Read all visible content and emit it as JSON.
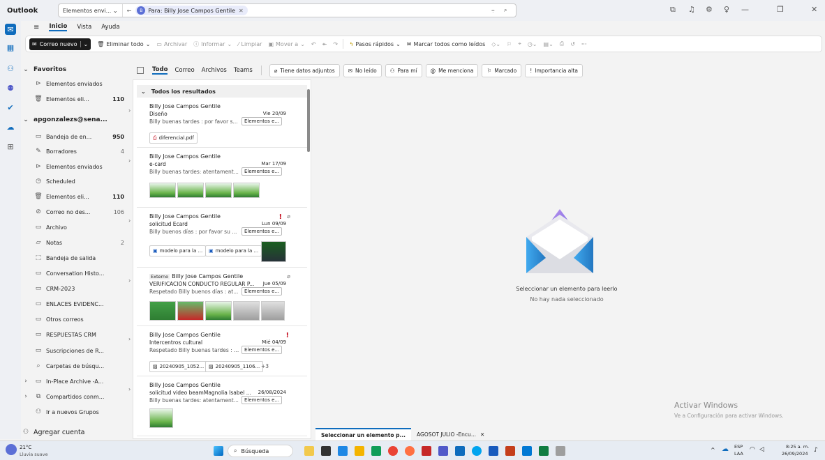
{
  "titlebar": {
    "app": "Outlook",
    "scope": "Elementos envi...",
    "search_chip_initial": "B",
    "search_chip": "Para: Billy Jose Campos Gentile",
    "filter_icon": "filter-icon",
    "search_icon": "search-icon"
  },
  "tabs": [
    "Inicio",
    "Vista",
    "Ayuda"
  ],
  "ribbon": {
    "new_mail": "Correo nuevo",
    "delete_all": "Eliminar todo",
    "archive": "Archivar",
    "report": "Informar",
    "clean": "Limpiar",
    "move_to": "Mover a",
    "quick_steps": "Pasos rápidos",
    "mark_all_read": "Marcar todos como leídos",
    "more": "···"
  },
  "folders": {
    "favorites": "Favoritos",
    "fav_sent": "Elementos enviados",
    "fav_deleted": "Elementos eli...",
    "fav_deleted_count": "110",
    "account": "apgonzalezs@sena...",
    "inbox": "Bandeja de en...",
    "inbox_count": "950",
    "drafts": "Borradores",
    "drafts_count": "4",
    "sent": "Elementos enviados",
    "scheduled": "Scheduled",
    "deleted": "Elementos eli...",
    "deleted_count": "110",
    "junk": "Correo no des...",
    "junk_count": "106",
    "archive": "Archivo",
    "notes": "Notas",
    "notes_count": "2",
    "outbox": "Bandeja de salida",
    "conv_history": "Conversation Histo...",
    "crm": "CRM-2023",
    "enlaces": "ENLACES EVIDENC...",
    "otros": "Otros correos",
    "respuestas": "RESPUESTAS CRM",
    "suscripciones": "Suscripciones de R...",
    "search_folders": "Carpetas de búsqu...",
    "inplace": "In-Place Archive -A...",
    "shared": "Compartidos conm...",
    "groups": "Ir a nuevos Grupos",
    "add_account": "Agregar cuenta"
  },
  "filters": {
    "todo": "Todo",
    "correo": "Correo",
    "archivos": "Archivos",
    "teams": "Teams",
    "attachments": "Tiene datos adjuntos",
    "unread": "No leído",
    "to_me": "Para mí",
    "mentions": "Me menciona",
    "flagged": "Marcado",
    "high_importance": "Importancia alta"
  },
  "list_header": "Todos los resultados",
  "messages": [
    {
      "sender": "Billy Jose Campos Gentile",
      "subject": "Diseño",
      "date": "Vie 20/09",
      "preview": "Billy buenas tardes : por favor s...",
      "tag": "Elementos e...",
      "attachment": "diferencial.pdf"
    },
    {
      "sender": "Billy Jose Campos Gentile",
      "subject": "e-card",
      "date": "Mar 17/09",
      "preview": "Billy buenas tardes: atentament...",
      "tag": "Elementos e..."
    },
    {
      "sender": "Billy Jose Campos Gentile",
      "subject": "solicitud Ecard",
      "date": "Lun 09/09",
      "preview": "Billy buenos días : por favor su ...",
      "tag": "Elementos e...",
      "att1": "modelo para la ...",
      "att2": "modelo para la ..."
    },
    {
      "external": "Externo",
      "sender": "Billy Jose Campos Gentile",
      "subject": "VERIFICACIÓN CONDUCTO REGULAR P...",
      "date": "Jue 05/09",
      "preview": "Respetado Billy buenos días : at...",
      "tag": "Elementos e..."
    },
    {
      "sender": "Billy Jose Campos Gentile",
      "subject": "Intercentros cultural",
      "date": "Mié 04/09",
      "preview": "Respetado Billy buenas tardes : ...",
      "tag": "Elementos e...",
      "att1": "20240905_1052...",
      "att2": "20240905_1106...",
      "more": "+3"
    },
    {
      "sender": "Billy Jose Campos Gentile",
      "subject": "solicitud video beamMagnolia Isabel ...",
      "date": "26/08/2024",
      "preview": "Billy buenas tardes: atentament...",
      "tag": "Elementos e..."
    }
  ],
  "reading": {
    "title": "Seleccionar un elemento para leerlo",
    "subtitle": "No hay nada seleccionado"
  },
  "bottom_tabs": [
    "Seleccionar un elemento p...",
    "AGOSOT JULIO -Encu..."
  ],
  "watermark": {
    "line1": "Activar Windows",
    "line2": "Ve a Configuración para activar Windows."
  },
  "taskbar": {
    "weather_temp": "21°C",
    "weather_desc": "Lluvia suave",
    "search": "Búsqueda",
    "lang1": "ESP",
    "lang2": "LAA",
    "time": "8:25 a. m.",
    "date": "26/09/2024"
  }
}
